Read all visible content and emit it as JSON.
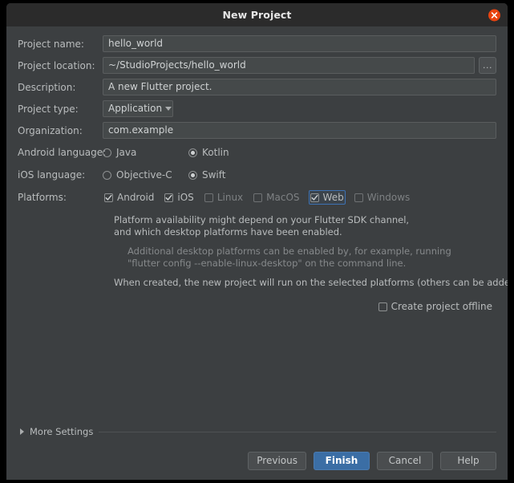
{
  "window": {
    "title": "New Project",
    "close_icon": "close-icon"
  },
  "form": {
    "fields": [
      {
        "label": "Project name:",
        "value": "hello_world"
      },
      {
        "label": "Project location:",
        "value": "~/StudioProjects/hello_world",
        "browse": "..."
      },
      {
        "label": "Description:",
        "value": "A new Flutter project."
      },
      {
        "label": "Project type:",
        "value": "Application"
      },
      {
        "label": "Organization:",
        "value": "com.example"
      }
    ],
    "android_language": {
      "label": "Android language:",
      "options": [
        {
          "label": "Java",
          "selected": false
        },
        {
          "label": "Kotlin",
          "selected": true
        }
      ]
    },
    "ios_language": {
      "label": "iOS language:",
      "options": [
        {
          "label": "Objective-C",
          "selected": false
        },
        {
          "label": "Swift",
          "selected": true
        }
      ]
    },
    "platforms": {
      "label": "Platforms:",
      "options": [
        {
          "label": "Android",
          "checked": true,
          "focused": false
        },
        {
          "label": "iOS",
          "checked": true,
          "focused": false
        },
        {
          "label": "Linux",
          "checked": false,
          "focused": false
        },
        {
          "label": "MacOS",
          "checked": false,
          "focused": false
        },
        {
          "label": "Web",
          "checked": true,
          "focused": true
        },
        {
          "label": "Windows",
          "checked": false,
          "focused": false
        }
      ]
    }
  },
  "notes": {
    "line1": "Platform availability might depend on your Flutter SDK channel,",
    "line2": "and which desktop platforms have been enabled.",
    "line3": "Additional desktop platforms can be enabled by, for example, running",
    "line4": "\"flutter config --enable-linux-desktop\" on the command line.",
    "line5": "When created, the new project will run on the selected platforms (others can be added later)."
  },
  "offline": {
    "label": "Create project offline",
    "checked": false
  },
  "footer": {
    "more_settings": "More Settings",
    "buttons": [
      {
        "label": "Previous",
        "primary": false
      },
      {
        "label": "Finish",
        "primary": true
      },
      {
        "label": "Cancel",
        "primary": false
      },
      {
        "label": "Help",
        "primary": false
      }
    ]
  },
  "colors": {
    "dialog_bg": "#3c3f41",
    "titlebar_bg": "#2b2b2b",
    "field_bg": "#45494a",
    "accent_blue": "#3b6ea5",
    "close_red": "#e8430f",
    "text": "#b9bcbd",
    "text_muted": "#86898b"
  }
}
